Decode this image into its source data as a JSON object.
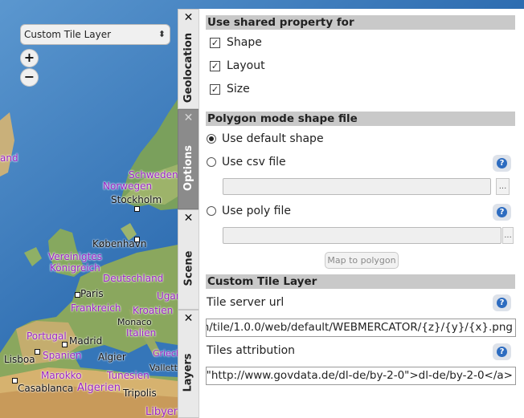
{
  "map": {
    "layer_select": {
      "value": "Custom Tile Layer"
    },
    "zoom_in": "+",
    "zoom_out": "−",
    "labels": {
      "and": "and",
      "schweden": "Schweden",
      "norwegen": "Norwegen",
      "stockholm": "Stockholm",
      "kobenhavn": "København",
      "vereinigtes": "Vereinigtes",
      "konigreich": "Königreich",
      "deutschland": "Deutschland",
      "paris": "Paris",
      "frankreich": "Frankreich",
      "kroatien": "Kroatien",
      "monaco": "Monaco",
      "italien": "Italien",
      "portugal": "Portugal",
      "madrid": "Madrid",
      "spanien": "Spanien",
      "lisboa": "Lisboa",
      "algier": "Algier",
      "griech": "Griech",
      "valletta": "Vallett",
      "marokko": "Marokko",
      "tunesien": "Tunesien",
      "casablanca": "Casablanca",
      "algerien": "Algerien",
      "tripolis": "Tripolis",
      "libyen": "Libyen",
      "ugan": "Ugan"
    }
  },
  "tabs": [
    {
      "label": "Geolocation",
      "close": "✕"
    },
    {
      "label": "Options",
      "close": "✕"
    },
    {
      "label": "Scene",
      "close": "✕"
    },
    {
      "label": "Layers",
      "close": "✕"
    }
  ],
  "panel": {
    "shared": {
      "header": "Use shared property for",
      "shape": {
        "label": "Shape",
        "checked": true,
        "mark": "✓"
      },
      "layout": {
        "label": "Layout",
        "checked": true,
        "mark": "✓"
      },
      "size": {
        "label": "Size",
        "checked": true,
        "mark": "✓"
      }
    },
    "polygon": {
      "header": "Polygon mode shape file",
      "default_shape": "Use default shape",
      "csv_file": "Use csv file",
      "poly_file": "Use poly file",
      "dots": "...",
      "map_button": "Map to polygon"
    },
    "tile": {
      "header": "Custom Tile Layer",
      "url_label": "Tile server url",
      "url_value": "n/tile/1.0.0/web/default/WEBMERCATOR/{z}/{y}/{x}.png",
      "attr_label": "Tiles attribution",
      "attr_value": "\"http://www.govdata.de/dl-de/by-2-0\">dl-de/by-2-0</a>"
    },
    "help_glyph": "?"
  },
  "colors": {
    "sea": "#2f6fb0",
    "land": "#6f9a55",
    "header_bg": "#c9c9c9",
    "help_blue": "#2d6cc0"
  }
}
